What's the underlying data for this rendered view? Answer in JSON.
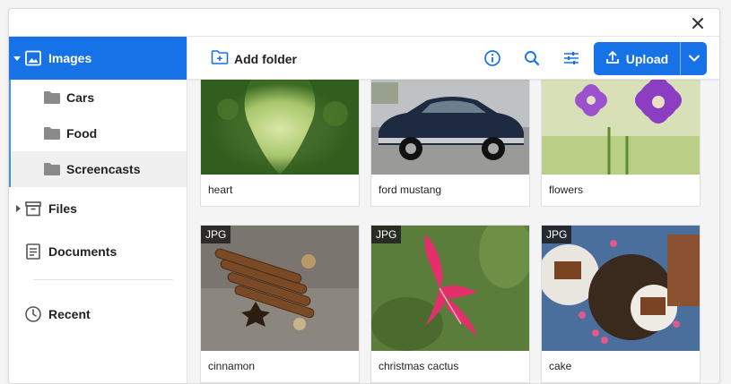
{
  "sidebar": {
    "images_label": "Images",
    "folders": [
      {
        "label": "Cars"
      },
      {
        "label": "Food"
      },
      {
        "label": "Screencasts"
      }
    ],
    "files_label": "Files",
    "documents_label": "Documents",
    "recent_label": "Recent"
  },
  "toolbar": {
    "add_folder_label": "Add folder",
    "upload_label": "Upload"
  },
  "files": [
    {
      "caption": "heart",
      "badge": ""
    },
    {
      "caption": "ford mustang",
      "badge": ""
    },
    {
      "caption": "flowers",
      "badge": ""
    },
    {
      "caption": "cinnamon",
      "badge": "JPG"
    },
    {
      "caption": "christmas cactus",
      "badge": "JPG"
    },
    {
      "caption": "cake",
      "badge": "JPG"
    }
  ],
  "colors": {
    "accent": "#1672e6"
  }
}
